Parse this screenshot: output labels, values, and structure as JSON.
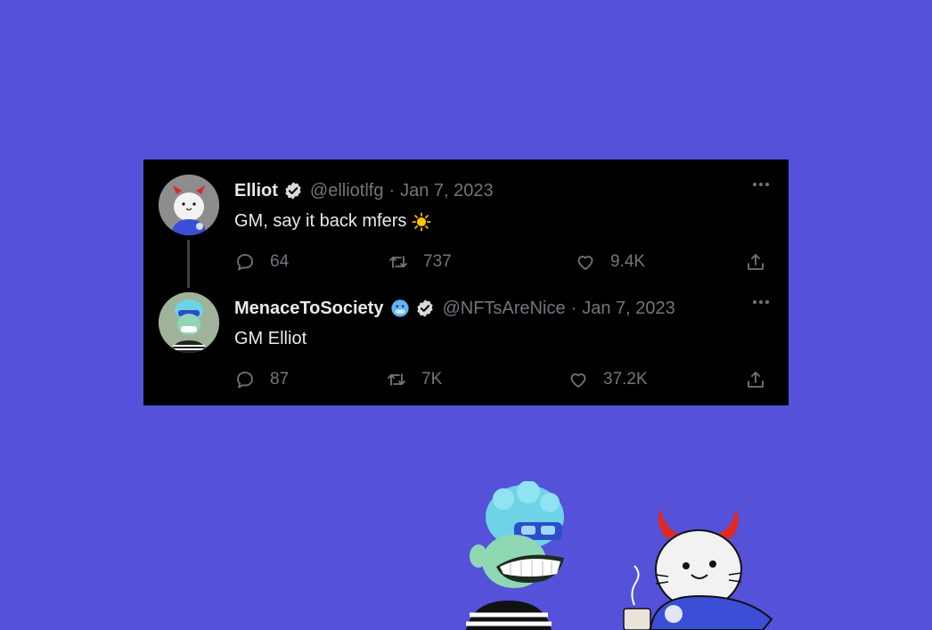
{
  "tweets": [
    {
      "name": "Elliot",
      "handle": "@elliotlfg",
      "separator": "·",
      "date": "Jan 7, 2023",
      "text": "GM, say it back mfers",
      "replies": "64",
      "retweets": "737",
      "likes": "9.4K"
    },
    {
      "name": "MenaceToSociety",
      "handle": "@NFTsAreNice",
      "separator": "·",
      "date": "Jan 7, 2023",
      "text": "GM Elliot",
      "replies": "87",
      "retweets": "7K",
      "likes": "37.2K"
    }
  ],
  "colors": {
    "background": "#5551d9",
    "card": "#000000",
    "text": "#e7e9ea",
    "muted": "#71767b"
  },
  "icons": [
    "verified-badge-icon",
    "cold-face-emoji-icon",
    "sun-emoji-icon",
    "reply-icon",
    "retweet-icon",
    "like-icon",
    "share-icon",
    "more-icon"
  ]
}
